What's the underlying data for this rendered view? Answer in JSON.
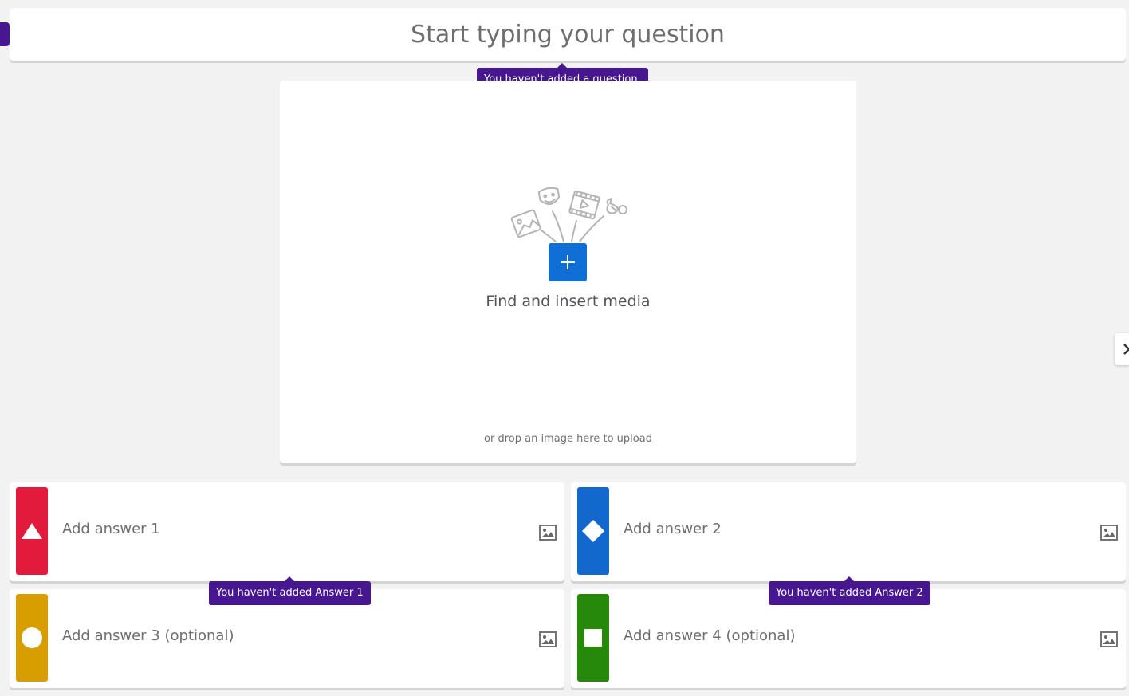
{
  "question": {
    "placeholder": "Start typing your question",
    "tooltip": "You haven't added a question."
  },
  "media": {
    "button_icon": "plus-icon",
    "label": "Find and insert media",
    "drop_hint": "or drop an image here to upload"
  },
  "answers": [
    {
      "placeholder": "Add answer 1",
      "color": "#e21b3c",
      "shape": "triangle",
      "icon": "image-icon"
    },
    {
      "placeholder": "Add answer 2",
      "color": "#1368ce",
      "shape": "diamond",
      "icon": "image-icon"
    },
    {
      "placeholder": "Add answer 3 (optional)",
      "color": "#d89e00",
      "shape": "circle",
      "icon": "image-icon"
    },
    {
      "placeholder": "Add answer 4 (optional)",
      "color": "#26890c",
      "shape": "square",
      "icon": "image-icon"
    }
  ],
  "tooltips": {
    "answer1": "You haven't added Answer 1",
    "answer2": "You haven't added Answer 2"
  },
  "colors": {
    "accent": "#46178f",
    "media_button": "#0f6fd6"
  }
}
